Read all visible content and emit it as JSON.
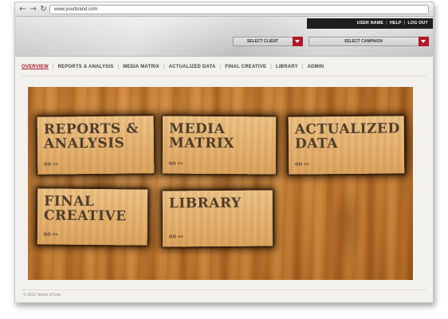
{
  "browser": {
    "url": "www.yourbrand.com",
    "back_glyph": "←",
    "forward_glyph": "→",
    "reload_glyph": "↻"
  },
  "utility_nav": {
    "user_name": "USER NAME",
    "help": "HELP",
    "logout": "LOG OUT",
    "separator": "|"
  },
  "selectors": {
    "client": "SELECT CLIENT",
    "campaign": "SELECT CAMPAIGN"
  },
  "main_nav": {
    "items": [
      {
        "label": "OVERVIEW",
        "active": true
      },
      {
        "label": "REPORTS & ANALYSIS"
      },
      {
        "label": "MEDIA MATRIX"
      },
      {
        "label": "ACTUALIZED DATA"
      },
      {
        "label": "FINAL CREATIVE"
      },
      {
        "label": "LIBRARY"
      },
      {
        "label": "ADMIN"
      }
    ],
    "divider": "|"
  },
  "tiles": {
    "reports": {
      "title": "REPORTS & ANALYSIS",
      "go": "GO >>"
    },
    "media": {
      "title": "MEDIA MATRIX",
      "go": "GO >>"
    },
    "actualized": {
      "title": "ACTUALIZED DATA",
      "go": "GO >>"
    },
    "final": {
      "title": "FINAL CREATIVE",
      "go": "GO >>"
    },
    "library": {
      "title": "LIBRARY",
      "go": "GO >>"
    }
  },
  "footer": {
    "text": "© 2012 Terms of Use."
  },
  "colors": {
    "accent_red": "#b4162a",
    "active_nav": "#a8172a",
    "utility_bar": "#1e1e1e",
    "wood": "#c57c32"
  }
}
